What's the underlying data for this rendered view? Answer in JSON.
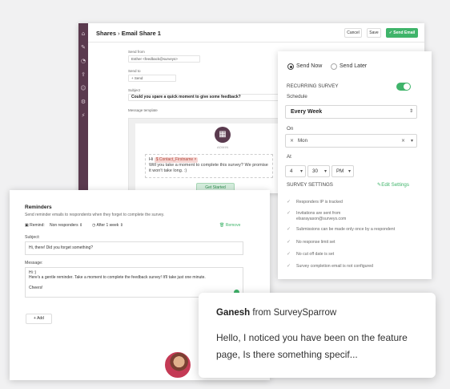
{
  "back_window": {
    "breadcrumb_root": "Shares",
    "breadcrumb_sep": "›",
    "breadcrumb_current": "Email Share 1",
    "cancel": "Cancel",
    "save": "Save",
    "send_email": "✓ Send Email",
    "send_from_label": "Send from",
    "send_from_value": "Esther <feedback@surveys>",
    "send_to_label": "Send to",
    "send_to_value": "+ Send",
    "subject_label": "Subject",
    "subject_value": "Could you spare a quick moment to give some feedback?",
    "template_label": "Message template",
    "admin_label": "ADMIN",
    "greeting_hi": "Hi",
    "contact_chip": "$ Contact_Firstname ×",
    "greeting_body": "Will you take a moment to complete this survey? We promise it won't take long. :)",
    "get_started": "Get Started"
  },
  "settings": {
    "send_now": "Send Now",
    "send_later": "Send Later",
    "recurring_label": "RECURRING SURVEY",
    "recurring_on": true,
    "schedule_label": "Schedule",
    "schedule_value": "Every Week",
    "on_label": "On",
    "on_value": "Mon",
    "at_label": "At",
    "at_hour": "4",
    "at_minute": "30",
    "at_ampm": "PM",
    "survey_settings": "SURVEY SETTINGS",
    "edit_settings": "Edit Settings",
    "features": [
      "Responders IP is tracked",
      "Invitations are sent from elsarayason@surveys.com",
      "Submissions can be made only once by a respondent",
      "No response limit set",
      "No cut off date is set",
      "Survey completion email is not configured"
    ],
    "accent": "#3fb46a"
  },
  "reminders": {
    "title": "Reminders",
    "description": "Send reminder emails to respondents when they forget to complete the survey.",
    "remind_label": "Remind:",
    "remind_value": "Non responders",
    "after_value": "After 1 week",
    "remove": "Remove",
    "subject_label": "Subject:",
    "subject_value": "Hi, there! Did you forget something?",
    "message_label": "Message:",
    "message_line1": "Hi :)",
    "message_line2": "Here's a gentle reminder. Take a moment to complete the feedback survey! It'll take just one minute.",
    "message_line3": "Cheers!",
    "add": "Add"
  },
  "chat": {
    "sender": "Ganesh",
    "from_word": "from SurveySparrow",
    "message": "Hello, I noticed you have been on the feature page, Is there something specif..."
  }
}
